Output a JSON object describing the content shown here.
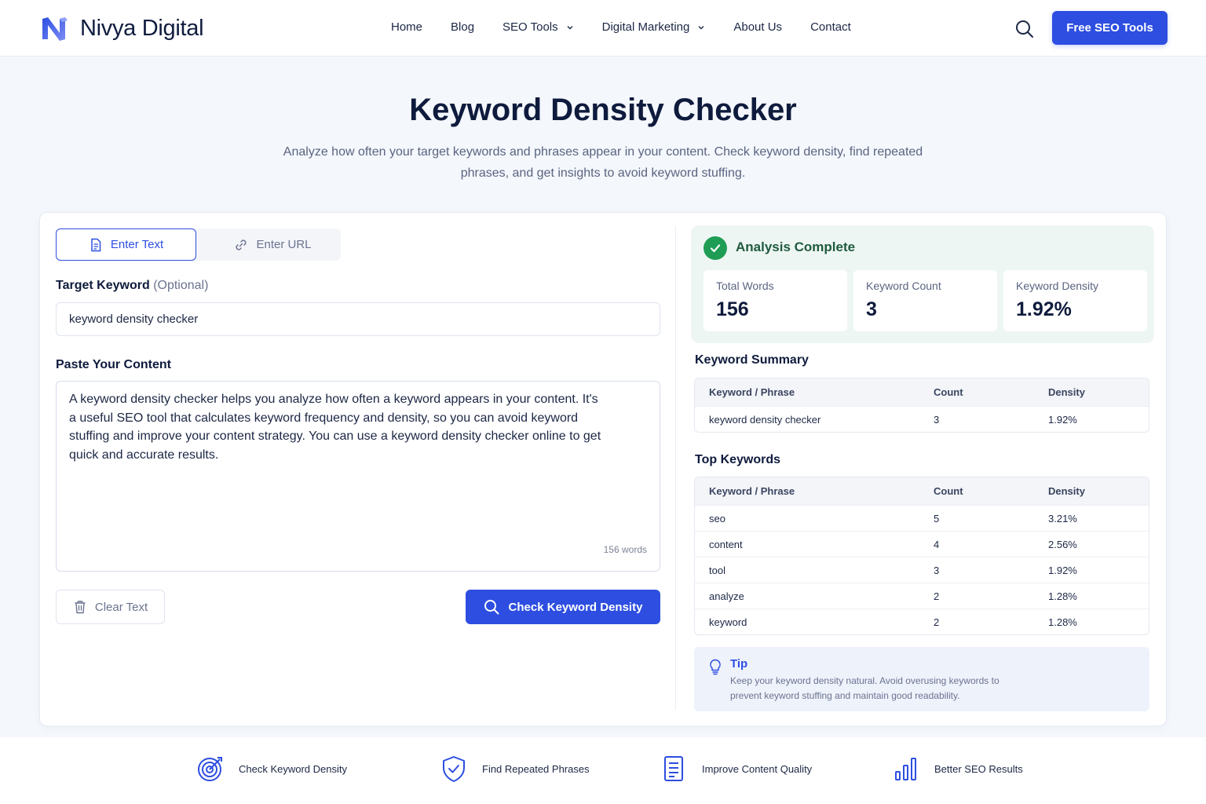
{
  "header": {
    "brand": "Nivya Digital",
    "nav": [
      {
        "label": "Home",
        "has_dropdown": false
      },
      {
        "label": "Blog",
        "has_dropdown": false
      },
      {
        "label": "SEO Tools",
        "has_dropdown": true
      },
      {
        "label": "Digital Marketing",
        "has_dropdown": true
      },
      {
        "label": "About Us",
        "has_dropdown": false
      },
      {
        "label": "Contact",
        "has_dropdown": false
      }
    ],
    "search_icon": "search-icon",
    "cta_label": "Free SEO Tools"
  },
  "hero": {
    "title": "Keyword Density Checker",
    "subtitle": "Analyze how often your target keywords and phrases appear in your content. Check keyword density, find repeated phrases, and get insights to avoid keyword stuffing."
  },
  "input_panel": {
    "tabs": [
      {
        "label": "Enter Text",
        "icon": "document-icon",
        "active": true
      },
      {
        "label": "Enter URL",
        "icon": "link-icon",
        "active": false
      }
    ],
    "keyword_label": "Target Keyword",
    "keyword_optional": "(Optional)",
    "keyword_value": "keyword density checker",
    "content_label": "Paste Your Content",
    "content_value": "A keyword density checker helps you analyze how often a keyword appears in your content. It's a useful SEO tool that calculates keyword frequency and density, so you can avoid keyword stuffing and improve your content strategy. You can use a keyword density checker online to get quick and accurate results.",
    "word_count": "156 words",
    "clear_label": "Clear Text",
    "check_label": "Check Keyword Density"
  },
  "results": {
    "status": "Analysis Complete",
    "stats": [
      {
        "label": "Total Words",
        "value": "156"
      },
      {
        "label": "Keyword Count",
        "value": "3"
      },
      {
        "label": "Keyword Density",
        "value": "1.92%"
      }
    ],
    "summary_title": "Keyword Summary",
    "columns": [
      "Keyword / Phrase",
      "Count",
      "Density"
    ],
    "summary_rows": [
      [
        "keyword density checker",
        "3",
        "1.92%"
      ]
    ],
    "top_title": "Top Keywords",
    "top_rows": [
      [
        "seo",
        "5",
        "3.21%"
      ],
      [
        "content",
        "4",
        "2.56%"
      ],
      [
        "tool",
        "3",
        "1.92%"
      ],
      [
        "analyze",
        "2",
        "1.28%"
      ],
      [
        "keyword",
        "2",
        "1.28%"
      ]
    ],
    "tip_title": "Tip",
    "tip_text": "Keep your keyword density natural. Avoid overusing keywords to prevent keyword stuffing and maintain good readability."
  },
  "features": [
    {
      "label": "Check Keyword Density",
      "icon": "target-icon"
    },
    {
      "label": "Find Repeated Phrases",
      "icon": "shield-check-icon"
    },
    {
      "label": "Improve Content Quality",
      "icon": "document-lines-icon"
    },
    {
      "label": "Better SEO Results",
      "icon": "bar-chart-icon"
    }
  ],
  "colors": {
    "primary": "#2d4ee0",
    "success": "#1f9d55",
    "success_bg": "#eef6f3",
    "heading": "#0f1b3d",
    "page_bg": "#f4f7fc"
  }
}
